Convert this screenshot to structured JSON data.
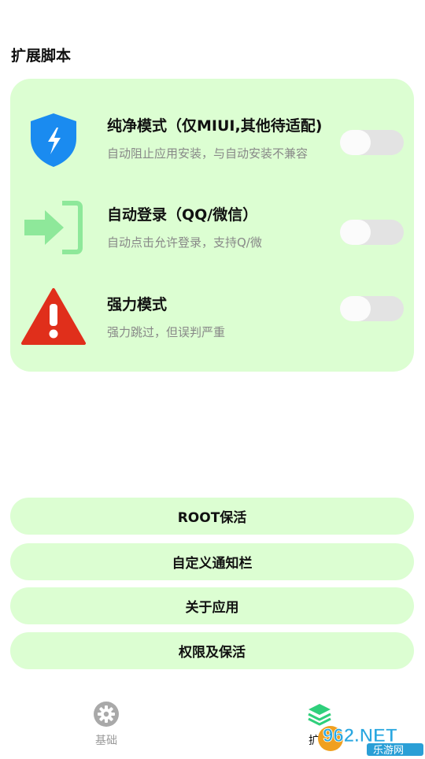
{
  "section": {
    "title": "扩展脚本"
  },
  "scripts": [
    {
      "title": "纯净模式（仅MIUI,其他待适配)",
      "desc": "自动阻止应用安装，与自动安装不兼容",
      "icon": "shield-bolt-icon",
      "enabled": false
    },
    {
      "title": "自动登录（QQ/微信）",
      "desc": "自动点击允许登录，支持Q/微",
      "icon": "login-arrow-icon",
      "enabled": false
    },
    {
      "title": "强力模式",
      "desc": "强力跳过，但误判严重",
      "icon": "warning-icon",
      "enabled": false
    }
  ],
  "buttons": {
    "root_keepalive": "ROOT保活",
    "custom_notification": "自定义通知栏",
    "about_app": "关于应用",
    "permissions_keepalive": "权限及保活"
  },
  "tabs": {
    "basic": "基础",
    "extend": "扩展"
  },
  "watermark": {
    "brand": "962.NET",
    "sub": "乐游网"
  },
  "colors": {
    "card_bg": "#dcfed2",
    "shield_blue": "#1a8bf0",
    "login_green": "#8ee89a",
    "warning_red": "#e02f1b",
    "tab_active_green": "#2fcf7b"
  }
}
